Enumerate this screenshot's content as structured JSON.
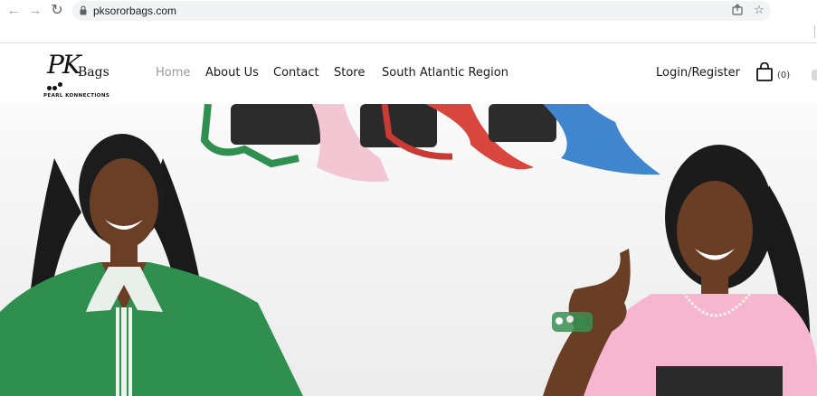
{
  "browser": {
    "url": "pksororbags.com",
    "back_icon": "arrow-left-icon",
    "forward_icon": "arrow-right-icon",
    "reload_icon": "reload-icon",
    "lock_icon": "lock-icon",
    "share_icon": "share-icon",
    "bookmark_icon": "star-icon"
  },
  "header": {
    "logo": {
      "monogram": "PK",
      "word": "Bags",
      "tagline": "PEARL KONNECTIONS"
    },
    "nav": [
      {
        "label": "Home",
        "active": true
      },
      {
        "label": "About Us",
        "active": false
      },
      {
        "label": "Contact",
        "active": false
      },
      {
        "label": "Store",
        "active": false
      },
      {
        "label": "South Atlantic Region",
        "active": false
      }
    ],
    "login_label": "Login/Register",
    "cart_count": "(0)",
    "cart_icon": "shopping-bag-icon"
  },
  "hero": {
    "image": "two women with sorority bags and scarves",
    "colors": {
      "green": "#2f8f4e",
      "pink": "#f3a6c8",
      "red": "#d8463e",
      "blue": "#3f86cf"
    }
  }
}
